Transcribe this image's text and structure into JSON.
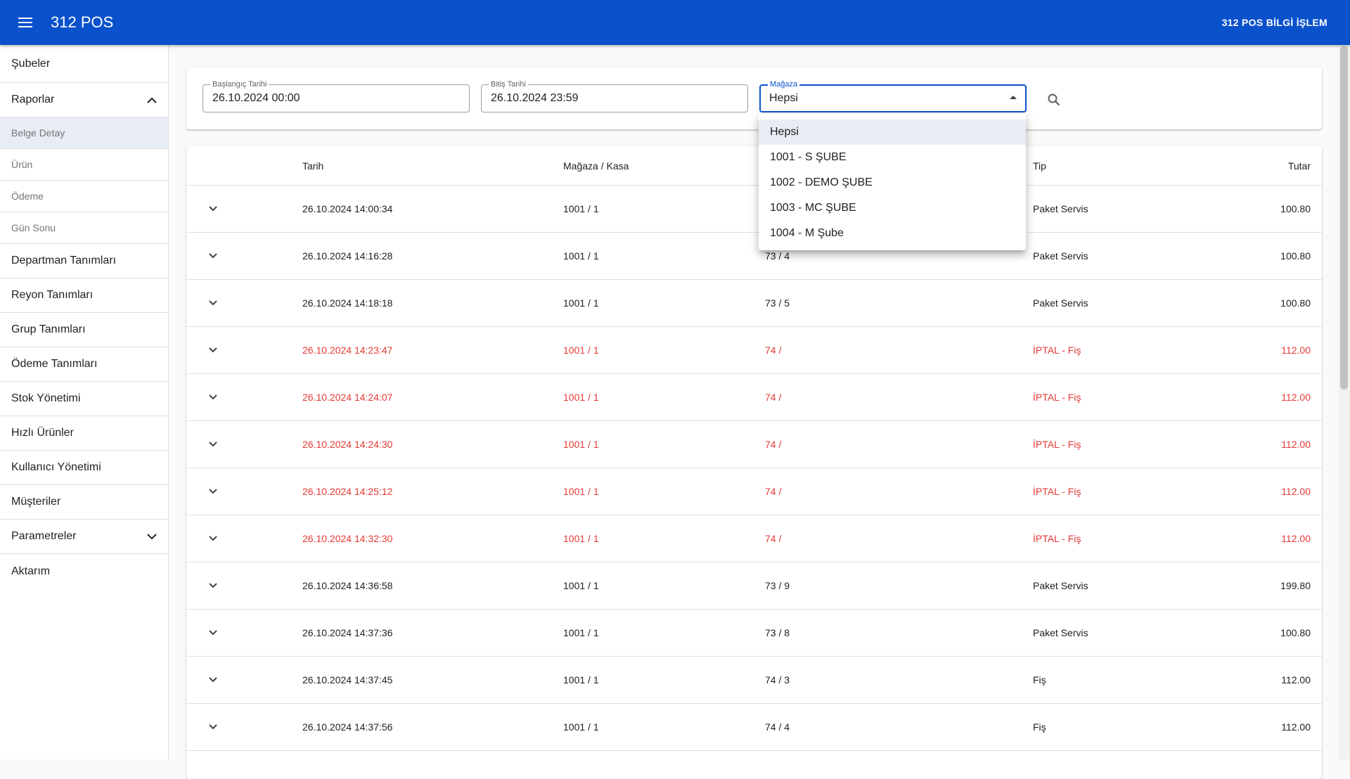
{
  "appbar": {
    "title": "312 POS",
    "user": "312 POS BİLGİ İŞLEM"
  },
  "sidebar": {
    "items": [
      {
        "label": "Şubeler"
      },
      {
        "label": "Raporlar"
      },
      {
        "label": "Departman Tanımları"
      },
      {
        "label": "Reyon Tanımları"
      },
      {
        "label": "Grup Tanımları"
      },
      {
        "label": "Ödeme Tanımları"
      },
      {
        "label": "Stok Yönetimi"
      },
      {
        "label": "Hızlı Ürünler"
      },
      {
        "label": "Kullanıcı Yönetimi"
      },
      {
        "label": "Müşteriler"
      },
      {
        "label": "Parametreler"
      },
      {
        "label": "Aktarım"
      }
    ],
    "report_subitems": [
      {
        "label": "Belge Detay",
        "active": true
      },
      {
        "label": "Ürün"
      },
      {
        "label": "Ödeme"
      },
      {
        "label": "Gün Sonu"
      }
    ]
  },
  "filters": {
    "start_label": "Başlangıç Tarihi",
    "start_value": "26.10.2024 00:00",
    "end_label": "Bitiş Tarihi",
    "end_value": "26.10.2024 23:59",
    "store_label": "Mağaza",
    "store_value": "Hepsi"
  },
  "store_options": [
    "Hepsi",
    "1001 - S ŞUBE",
    "1002 - DEMO ŞUBE",
    "1003 - MC ŞUBE",
    "1004 - M Şube"
  ],
  "table": {
    "headers": {
      "date": "Tarih",
      "store": "Mağaza / Kasa",
      "doc": "",
      "type": "Tip",
      "total": "Tutar"
    },
    "rows": [
      {
        "date": "26.10.2024 14:00:34",
        "store": "1001 / 1",
        "doc": "",
        "type": "Paket Servis",
        "total": "100.80",
        "cancelled": false
      },
      {
        "date": "26.10.2024 14:16:28",
        "store": "1001 / 1",
        "doc": "73 / 4",
        "type": "Paket Servis",
        "total": "100.80",
        "cancelled": false
      },
      {
        "date": "26.10.2024 14:18:18",
        "store": "1001 / 1",
        "doc": "73 / 5",
        "type": "Paket Servis",
        "total": "100.80",
        "cancelled": false
      },
      {
        "date": "26.10.2024 14:23:47",
        "store": "1001 / 1",
        "doc": "74 /",
        "type": "İPTAL - Fiş",
        "total": "112.00",
        "cancelled": true
      },
      {
        "date": "26.10.2024 14:24:07",
        "store": "1001 / 1",
        "doc": "74 /",
        "type": "İPTAL - Fiş",
        "total": "112.00",
        "cancelled": true
      },
      {
        "date": "26.10.2024 14:24:30",
        "store": "1001 / 1",
        "doc": "74 /",
        "type": "İPTAL - Fiş",
        "total": "112.00",
        "cancelled": true
      },
      {
        "date": "26.10.2024 14:25:12",
        "store": "1001 / 1",
        "doc": "74 /",
        "type": "İPTAL - Fiş",
        "total": "112.00",
        "cancelled": true
      },
      {
        "date": "26.10.2024 14:32:30",
        "store": "1001 / 1",
        "doc": "74 /",
        "type": "İPTAL - Fiş",
        "total": "112.00",
        "cancelled": true
      },
      {
        "date": "26.10.2024 14:36:58",
        "store": "1001 / 1",
        "doc": "73 / 9",
        "type": "Paket Servis",
        "total": "199.80",
        "cancelled": false
      },
      {
        "date": "26.10.2024 14:37:36",
        "store": "1001 / 1",
        "doc": "73 / 8",
        "type": "Paket Servis",
        "total": "100.80",
        "cancelled": false
      },
      {
        "date": "26.10.2024 14:37:45",
        "store": "1001 / 1",
        "doc": "74 / 3",
        "type": "Fiş",
        "total": "112.00",
        "cancelled": false
      },
      {
        "date": "26.10.2024 14:37:56",
        "store": "1001 / 1",
        "doc": "74 / 4",
        "type": "Fiş",
        "total": "112.00",
        "cancelled": false
      }
    ]
  },
  "colors": {
    "appbar": "#0a51cc",
    "cancelled_text": "#e53935",
    "active_bg": "#e8edf5"
  }
}
